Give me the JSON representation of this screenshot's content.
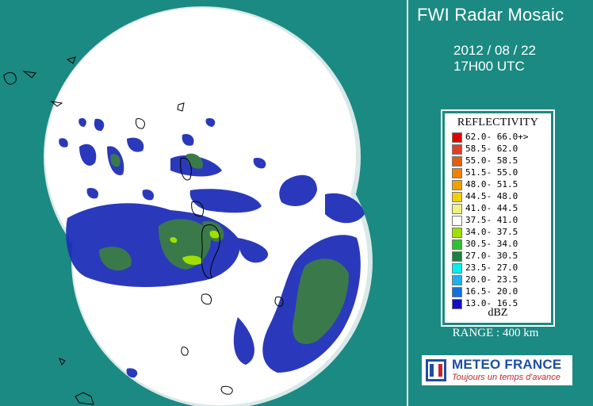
{
  "header": {
    "title": "FWI Radar Mosaic",
    "date": "2012 / 08 / 22",
    "time": "17H00 UTC"
  },
  "legend": {
    "title": "REFLECTIVITY",
    "unit": "dBZ",
    "rows": [
      {
        "label": "62.0- 66.0+>",
        "color": "#e00000"
      },
      {
        "label": "58.5- 62.0",
        "color": "#e0402a"
      },
      {
        "label": "55.0- 58.5",
        "color": "#e06010"
      },
      {
        "label": "51.5- 55.0",
        "color": "#f08000"
      },
      {
        "label": "48.0- 51.5",
        "color": "#f0a000"
      },
      {
        "label": "44.5- 48.0",
        "color": "#f0d000"
      },
      {
        "label": "41.0- 44.5",
        "color": "#f0f080"
      },
      {
        "label": "37.5- 41.0",
        "color": "#ffffff"
      },
      {
        "label": "34.0- 37.5",
        "color": "#a0e000"
      },
      {
        "label": "30.5- 34.0",
        "color": "#30c030"
      },
      {
        "label": "27.0- 30.5",
        "color": "#208040"
      },
      {
        "label": "23.5- 27.0",
        "color": "#00f0f0"
      },
      {
        "label": "20.0- 23.5",
        "color": "#20b0f0"
      },
      {
        "label": "16.5- 20.0",
        "color": "#1070e0"
      },
      {
        "label": "13.0- 16.5",
        "color": "#1010c0"
      }
    ]
  },
  "range": "RANGE : 400 km",
  "logo": {
    "name": "METEO FRANCE",
    "tagline": "Toujours un temps d'avance"
  },
  "colors": {
    "background": "#1b8a82",
    "radar_disc": "#ffffff",
    "light_echo": "#1f2fb8",
    "moderate_echo": "#3a7a4a"
  }
}
